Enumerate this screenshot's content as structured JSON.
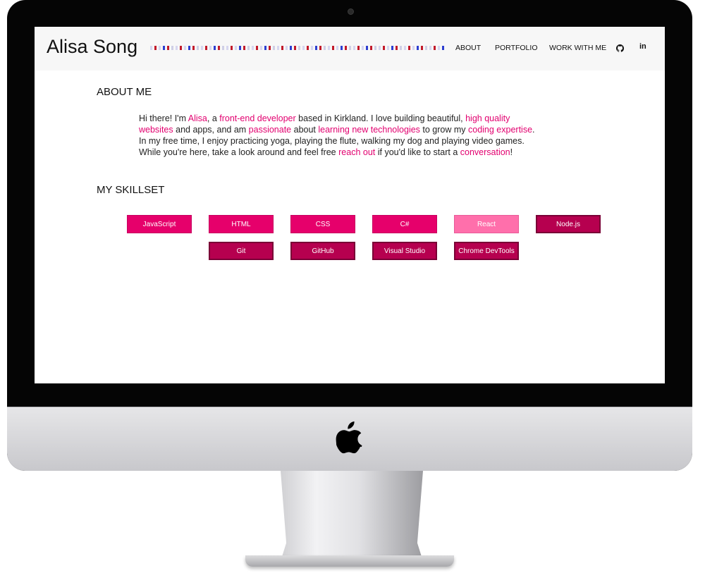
{
  "site": {
    "title": "Alisa Song"
  },
  "nav": {
    "about": "ABOUT",
    "portfolio": "PORTFOLIO",
    "work": "WORK WITH ME"
  },
  "icons": [
    "github-icon",
    "linkedin-icon",
    "apple-logo-icon"
  ],
  "linkedin_glyph": "in",
  "about": {
    "title": "ABOUT ME",
    "segments": [
      {
        "text": "Hi there! I'm ",
        "highlight": false
      },
      {
        "text": "Alisa",
        "highlight": true
      },
      {
        "text": ", a ",
        "highlight": false
      },
      {
        "text": "front-end developer",
        "highlight": true
      },
      {
        "text": " based in Kirkland. I love building beautiful, ",
        "highlight": false
      },
      {
        "text": "high quality websites",
        "highlight": true
      },
      {
        "text": " and apps, and am ",
        "highlight": false
      },
      {
        "text": "passionate",
        "highlight": true
      },
      {
        "text": " about ",
        "highlight": false
      },
      {
        "text": "learning new technologies",
        "highlight": true
      },
      {
        "text": " to grow my ",
        "highlight": false
      },
      {
        "text": "coding expertise",
        "highlight": true
      },
      {
        "text": ". In my free time, I enjoy practicing yoga, playing the flute, walking my dog and playing video games. While you're here, take a look around and feel free ",
        "highlight": false
      },
      {
        "text": "reach out",
        "highlight": true
      },
      {
        "text": " if you'd like to start a ",
        "highlight": false
      },
      {
        "text": "conversation",
        "highlight": true
      },
      {
        "text": "!",
        "highlight": false
      }
    ]
  },
  "skills": {
    "title": "MY SKILLSET",
    "items": [
      {
        "label": "JavaScript",
        "style": "primary"
      },
      {
        "label": "HTML",
        "style": "primary"
      },
      {
        "label": "CSS",
        "style": "primary"
      },
      {
        "label": "C#",
        "style": "primary"
      },
      {
        "label": "React",
        "style": "light"
      },
      {
        "label": "Node.js",
        "style": "dark"
      },
      {
        "label": "Git",
        "style": "dark"
      },
      {
        "label": "GitHub",
        "style": "dark"
      },
      {
        "label": "Visual Studio",
        "style": "dark"
      },
      {
        "label": "Chrome DevTools",
        "style": "dark"
      }
    ]
  },
  "colors": {
    "accent": "#e2006f",
    "skill_primary": "#e6006b",
    "skill_light": "#ff6fab",
    "skill_dark": "#b6004f"
  }
}
